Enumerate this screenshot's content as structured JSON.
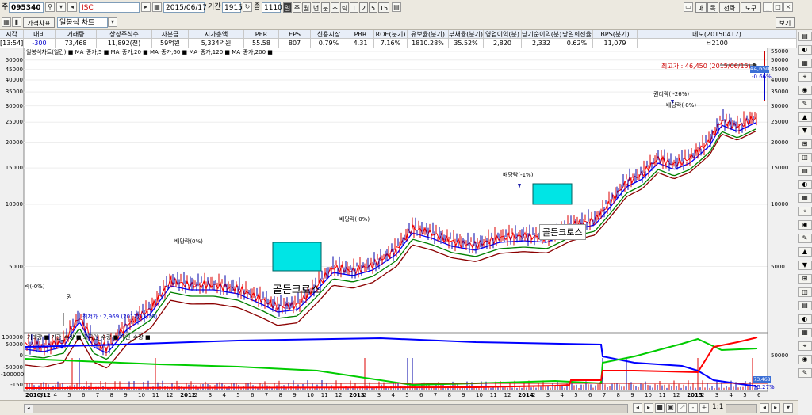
{
  "toolbar": {
    "code": "095340",
    "name": "ISC",
    "chart_type": "일봉식 차트",
    "price_table": "가격차표",
    "date": "2015/06/17",
    "period_label": "기간",
    "period_value": "1915",
    "count_label": "종",
    "count_value": "1110",
    "intervals": [
      "일",
      "주",
      "월",
      "년",
      "분",
      "초",
      "틱"
    ],
    "minutes": [
      "1",
      "2",
      "5",
      "15"
    ],
    "right_buttons": [
      "매",
      "목",
      "전략",
      "도구"
    ],
    "view_button": "보기"
  },
  "info_headers": [
    "시각",
    "대비",
    "거래량",
    "상장주식수",
    "자본금",
    "시가총액",
    "PER",
    "EPS",
    "신용시장",
    "PBR",
    "ROE(분기)",
    "유보율(분기)",
    "부채율(분기)",
    "영업이익(분)",
    "당기순이익(분)",
    "당일회전율",
    "BPS(분기)",
    "메모(20150417)"
  ],
  "info_values": [
    "[13:54]",
    "-300",
    "73,468",
    "11,892(천)",
    "59억원",
    "5,334억원",
    "55.58",
    "807",
    "0.79%",
    "4.31",
    "7.16%",
    "1810.28%",
    "35.52%",
    "2,820",
    "2,332",
    "0.62%",
    "11,079",
    "ㅂ2100"
  ],
  "price_chart": {
    "legend": "일봉식차트(일간) ■ MA_종가,5 ■ MA_종가,20 ■ MA_종가,60 ■ MA_종가,120 ■ MA_종가,200 ■",
    "y_ticks_left": [
      "50000",
      "45000",
      "40000",
      "35000",
      "30000",
      "25000",
      "20000",
      "15000",
      "10000",
      "5000"
    ],
    "y_ticks_right": [
      "55000",
      "50000",
      "45000",
      "40000",
      "35000",
      "30000",
      "25000",
      "20000",
      "15000",
      "10000",
      "5000"
    ],
    "current_price": "44,650",
    "current_change": "-0.66%",
    "annotations": {
      "high": "최고가 : 46,450 (2015/06/15)",
      "low": "최저가 : 2,969 (2011/03/16)",
      "gc1": "골든크로스",
      "gc2": "골든크로스",
      "div1": "배당락(-1%)",
      "div2": "배당락( 0%)",
      "div3": "배당락(0%)",
      "rights": "권리락( -26%)",
      "div4": "배당락( 0%)",
      "left1": "락(-0%)",
      "left2": "권"
    }
  },
  "volume_chart": {
    "legend": "거래량 ■ 기관_수량 ■ 외국인_수량 ■ 개인_수량 ■",
    "y_ticks_left": [
      "100000",
      "50000",
      "0",
      "-50000",
      "-100000",
      "-150"
    ],
    "y_ticks_right": [
      "50000"
    ],
    "right_value": "73,468",
    "right_percent": "75.27%"
  },
  "x_axis": [
    "2010/12",
    "3",
    "4",
    "5",
    "6",
    "7",
    "8",
    "9",
    "10",
    "11",
    "12",
    "2012",
    "2",
    "3",
    "4",
    "5",
    "6",
    "7",
    "8",
    "9",
    "10",
    "11",
    "12",
    "2013",
    "2",
    "3",
    "4",
    "5",
    "6",
    "7",
    "8",
    "9",
    "10",
    "11",
    "12",
    "2014",
    "2",
    "3",
    "4",
    "5",
    "6",
    "7",
    "8",
    "9",
    "10",
    "11",
    "12",
    "2015",
    "2",
    "3",
    "4",
    "5",
    "6"
  ],
  "bottom_bar": {
    "zoom": "1:1",
    "plus": "+",
    "minus": "-"
  },
  "colors": {
    "ma5": "#ff0000",
    "ma20": "#0000ff",
    "ma60": "#008000",
    "ma120": "#8b0000",
    "highlight": "#00e5e5",
    "institution": "#ff0000",
    "foreign": "#00cc00",
    "individual": "#0000ff"
  }
}
